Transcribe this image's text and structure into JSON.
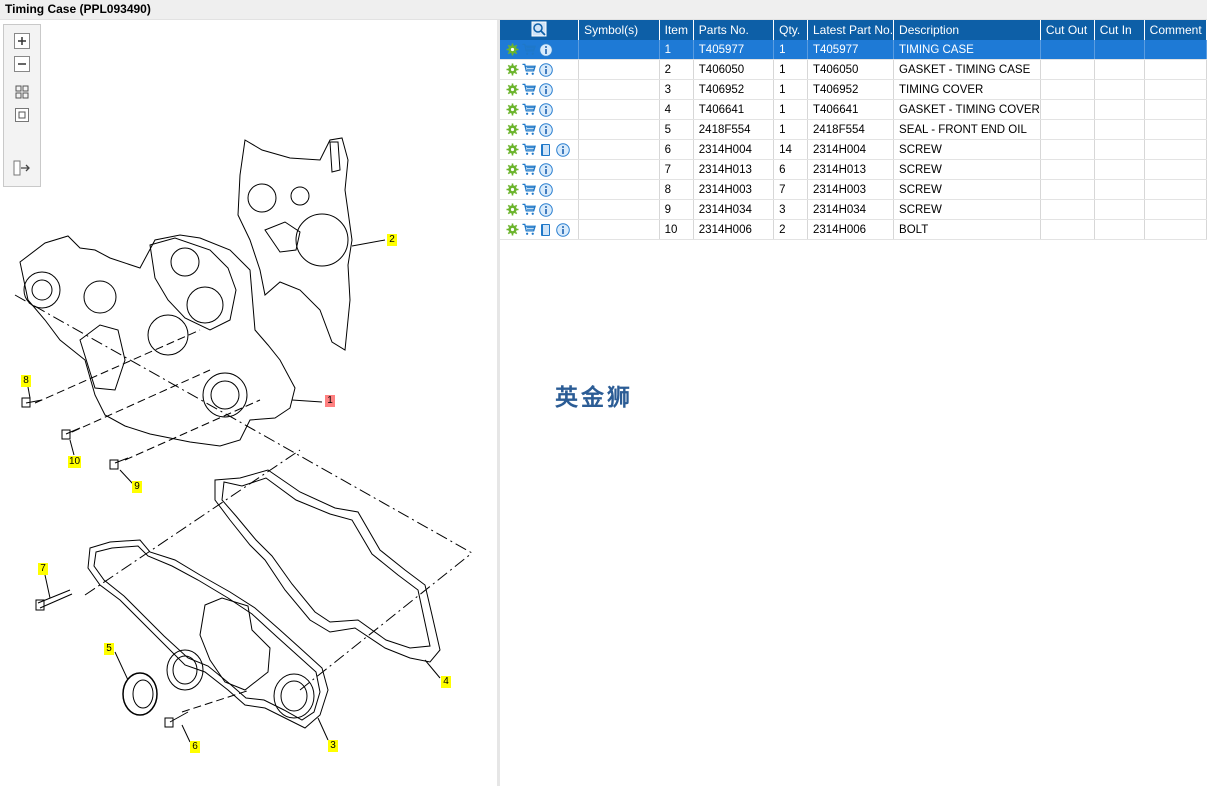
{
  "title": "Timing Case (PPL093490)",
  "toolbar": {
    "zoom_in": "zoom-in-icon",
    "zoom_out": "zoom-out-icon",
    "fit_all": "fit-all-icon",
    "fit_window": "fit-window-icon",
    "export": "export-icon"
  },
  "callouts": [
    "1",
    "2",
    "3",
    "4",
    "5",
    "6",
    "7",
    "8",
    "9",
    "10"
  ],
  "grid": {
    "columns": [
      "Symbol(s)",
      "Item",
      "Parts No.",
      "Qty.",
      "Latest Part No.",
      "Description",
      "Cut Out",
      "Cut In",
      "Comment"
    ],
    "rows": [
      {
        "item": "1",
        "part_no": "T405977",
        "qty": "1",
        "latest": "T405977",
        "desc": "TIMING CASE",
        "book": false,
        "selected": true
      },
      {
        "item": "2",
        "part_no": "T406050",
        "qty": "1",
        "latest": "T406050",
        "desc": "GASKET - TIMING CASE",
        "book": false,
        "selected": false
      },
      {
        "item": "3",
        "part_no": "T406952",
        "qty": "1",
        "latest": "T406952",
        "desc": "TIMING COVER",
        "book": false,
        "selected": false
      },
      {
        "item": "4",
        "part_no": "T406641",
        "qty": "1",
        "latest": "T406641",
        "desc": "GASKET - TIMING COVER",
        "book": false,
        "selected": false
      },
      {
        "item": "5",
        "part_no": "2418F554",
        "qty": "1",
        "latest": "2418F554",
        "desc": "SEAL - FRONT END OIL",
        "book": false,
        "selected": false
      },
      {
        "item": "6",
        "part_no": "2314H004",
        "qty": "14",
        "latest": "2314H004",
        "desc": "SCREW",
        "book": true,
        "selected": false
      },
      {
        "item": "7",
        "part_no": "2314H013",
        "qty": "6",
        "latest": "2314H013",
        "desc": "SCREW",
        "book": false,
        "selected": false
      },
      {
        "item": "8",
        "part_no": "2314H003",
        "qty": "7",
        "latest": "2314H003",
        "desc": "SCREW",
        "book": false,
        "selected": false
      },
      {
        "item": "9",
        "part_no": "2314H034",
        "qty": "3",
        "latest": "2314H034",
        "desc": "SCREW",
        "book": false,
        "selected": false
      },
      {
        "item": "10",
        "part_no": "2314H006",
        "qty": "2",
        "latest": "2314H006",
        "desc": "BOLT",
        "book": true,
        "selected": false
      }
    ]
  },
  "watermark": "英金狮",
  "colors": {
    "header": "#0d5fa7",
    "selected": "#1e7ad6",
    "callout": "#ffff00",
    "callout_highlight": "#ff8080"
  }
}
